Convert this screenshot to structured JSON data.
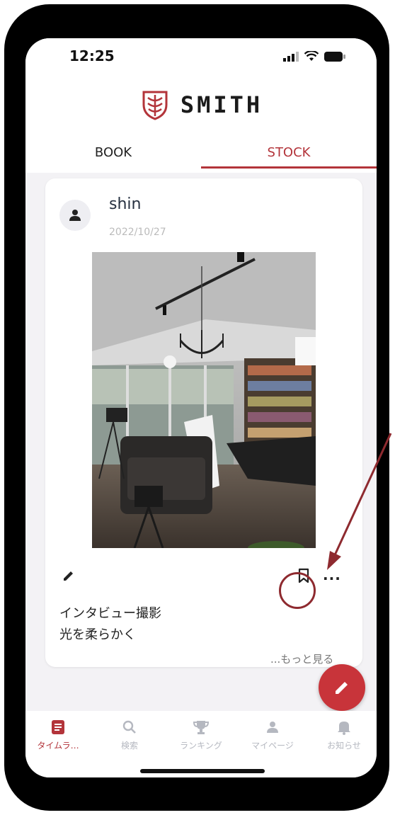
{
  "status_bar": {
    "time": "12:25"
  },
  "header": {
    "logo_text": "SMITH",
    "tabs": [
      {
        "label": "BOOK",
        "active": false
      },
      {
        "label": "STOCK",
        "active": true
      }
    ]
  },
  "post": {
    "username": "shin",
    "date": "2022/10/27",
    "caption_lines": [
      "インタビュー撮影",
      "光を柔らかく"
    ],
    "more_link": "...もっと見る",
    "more_menu": "..."
  },
  "bottom_nav": {
    "items": [
      {
        "label": "タイムラ…",
        "icon": "timeline-icon",
        "active": true
      },
      {
        "label": "検索",
        "icon": "search-icon",
        "active": false
      },
      {
        "label": "ランキング",
        "icon": "trophy-icon",
        "active": false
      },
      {
        "label": "マイページ",
        "icon": "person-icon",
        "active": false
      },
      {
        "label": "お知らせ",
        "icon": "bell-icon",
        "active": false
      }
    ]
  },
  "colors": {
    "accent": "#b3343a",
    "fab": "#c8343a",
    "annotation": "#8e2a2f"
  }
}
